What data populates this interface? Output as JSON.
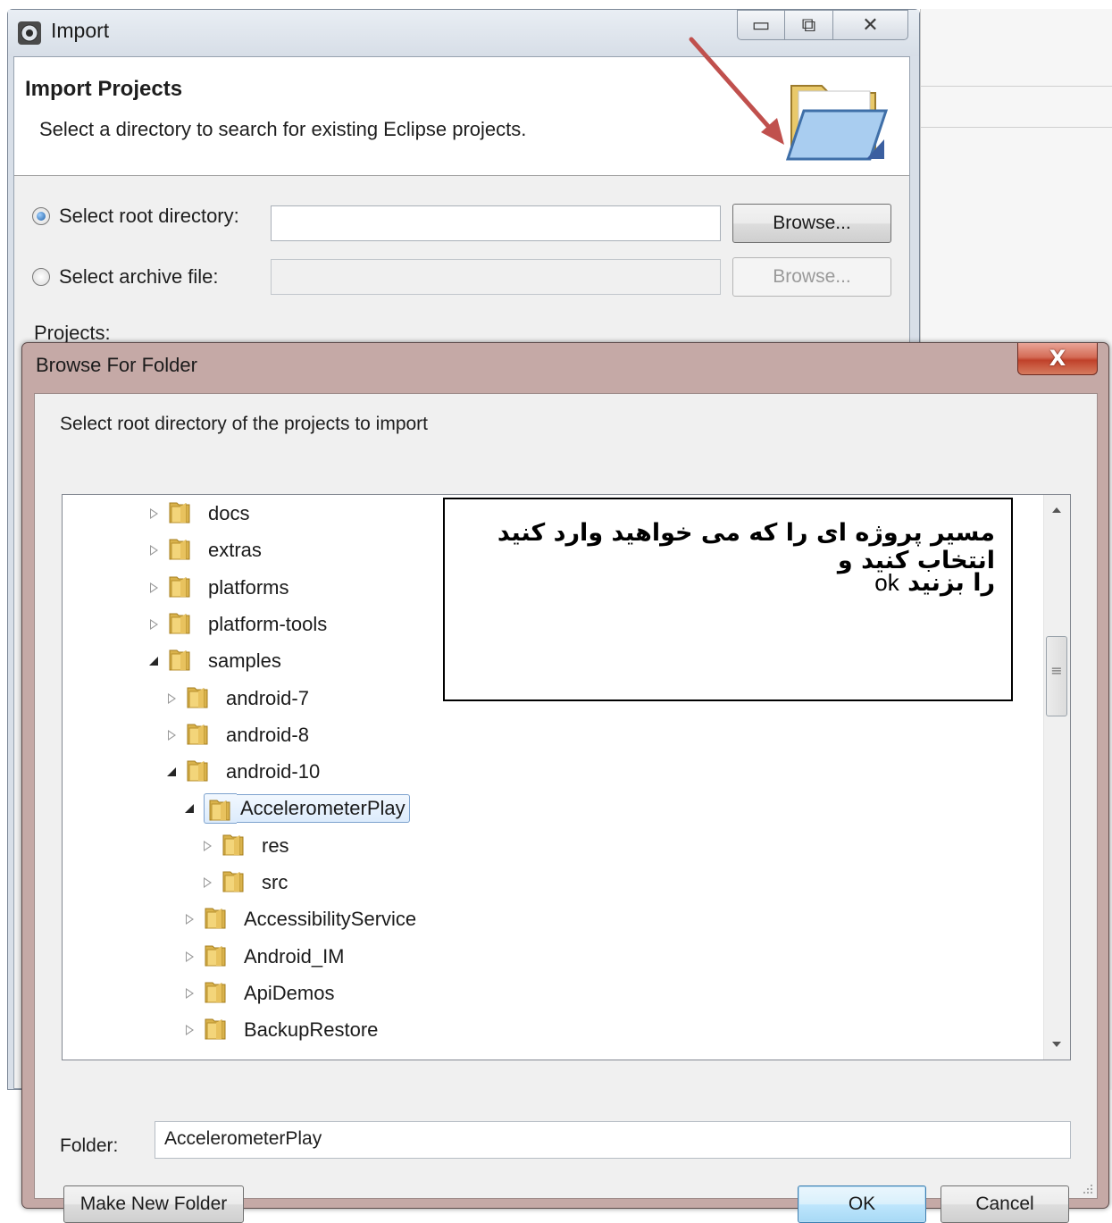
{
  "import_dialog": {
    "window_title": "Import",
    "header_title": "Import Projects",
    "header_description": "Select a directory to search for existing Eclipse projects.",
    "root_directory_label": "Select root directory:",
    "root_directory_value": "",
    "archive_file_label": "Select archive file:",
    "archive_file_value": "",
    "browse_label": "Browse...",
    "browse_archive_label": "Browse...",
    "projects_label": "Projects:",
    "selected_option": "root_directory"
  },
  "browse_dialog": {
    "title": "Browse For Folder",
    "close_glyph": "X",
    "instruction": "Select root directory of the projects to import",
    "tree": [
      {
        "label": "docs",
        "state": "collapsed",
        "depth": 0
      },
      {
        "label": "extras",
        "state": "collapsed",
        "depth": 0
      },
      {
        "label": "platforms",
        "state": "collapsed",
        "depth": 0
      },
      {
        "label": "platform-tools",
        "state": "collapsed",
        "depth": 0
      },
      {
        "label": "samples",
        "state": "expanded",
        "depth": 0
      },
      {
        "label": "android-7",
        "state": "collapsed",
        "depth": 1
      },
      {
        "label": "android-8",
        "state": "collapsed",
        "depth": 1
      },
      {
        "label": "android-10",
        "state": "expanded",
        "depth": 1
      },
      {
        "label": "AccelerometerPlay",
        "state": "expanded",
        "depth": 2,
        "selected": true
      },
      {
        "label": "res",
        "state": "collapsed",
        "depth": 3
      },
      {
        "label": "src",
        "state": "collapsed",
        "depth": 3
      },
      {
        "label": "AccessibilityService",
        "state": "collapsed",
        "depth": 2
      },
      {
        "label": "Android_IM",
        "state": "collapsed",
        "depth": 2
      },
      {
        "label": "ApiDemos",
        "state": "collapsed",
        "depth": 2
      },
      {
        "label": "BackupRestore",
        "state": "collapsed",
        "depth": 2
      }
    ],
    "annotation": {
      "line1": "مسیر پروژه ای را که می خواهید وارد کنید انتخاب کنید و",
      "line2_ok": "ok",
      "line2_rest": "را بزنید"
    },
    "folder_label": "Folder:",
    "folder_value": "AccelerometerPlay",
    "make_new_folder_label": "Make New Folder",
    "ok_label": "OK",
    "cancel_label": "Cancel"
  },
  "colors": {
    "annotation_arrow": "#c0504d",
    "selection_border": "#7da2ce",
    "close_button": "#c0412a"
  },
  "icons": [
    "eclipse-import-icon",
    "open-folder-icon",
    "folder-icon",
    "expand-arrow-icon",
    "collapse-arrow-icon",
    "close-icon",
    "size-grip-icon"
  ]
}
